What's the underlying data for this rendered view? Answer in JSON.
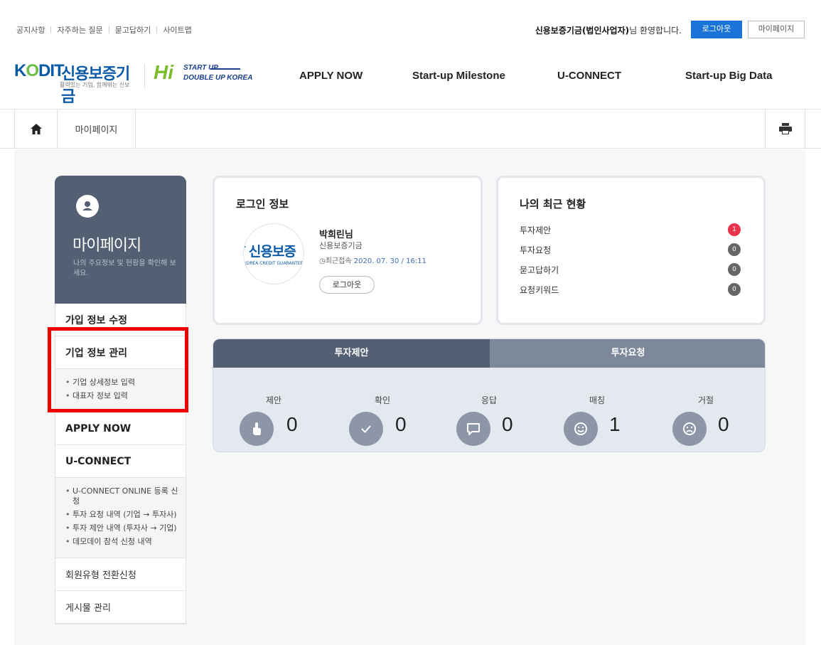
{
  "utility": {
    "links": [
      "공지사항",
      "자주하는 질문",
      "묻고답하기",
      "사이트맵"
    ],
    "welcome_name": "신용보증기금(법인사업자)",
    "welcome_suffix": "님 환영합니다.",
    "logout": "로그아웃",
    "mypage": "마이페이지"
  },
  "header": {
    "logo_kodit": "K",
    "logo_kodit_o": "O",
    "logo_kodit_rest": "DIT",
    "logo_name": "신용보증기금",
    "logo_slogan": "활력있는 기업, 함께뛰는 신보",
    "hi": "Hi",
    "startup": "START UP",
    "doubleup": "DOUBLE UP KOREA",
    "nav": [
      "APPLY NOW",
      "Start-up Milestone",
      "U-CONNECT",
      "Start-up Big Data"
    ]
  },
  "breadcrumb": {
    "current": "마이페이지"
  },
  "sidebar": {
    "title": "마이페이지",
    "desc": "나의 주요정보 및 현황을 확인해 보세요.",
    "menu": {
      "m1": "가입 정보 수정",
      "m2": "기업 정보 관리",
      "m2_sub": [
        "기업 상세정보 입력",
        "대표자 정보 입력"
      ],
      "m3": "APPLY NOW",
      "m4": "U-CONNECT",
      "m4_sub": [
        "U-CONNECT ONLINE 등록 신청",
        "투자 요청 내역 (기업 → 투자사)",
        "투자 제안 내역 (투자사 → 기업)",
        "데모데이 참석 신청 내역"
      ],
      "m5": "회원유형 전환신청",
      "m6": "게시물 관리"
    }
  },
  "login_card": {
    "title": "로그인 정보",
    "avatar_big": "ſ 신용보증",
    "avatar_small": "KOREA CREDIT GUARANTEE",
    "user_name": "박희린님",
    "org": "신용보증기금",
    "last_label": "최근접속",
    "last_time": "2020. 07. 30 / 16:11",
    "logout_button": "로그아웃"
  },
  "status_card": {
    "title": "나의 최근 현황",
    "rows": [
      {
        "label": "투자제안",
        "count": "1"
      },
      {
        "label": "투자요청",
        "count": "0"
      },
      {
        "label": "묻고답하기",
        "count": "0"
      },
      {
        "label": "요청키워드",
        "count": "0"
      }
    ]
  },
  "tabs": {
    "t1": "투자제안",
    "t2": "투자요청",
    "stats": [
      {
        "label": "제안",
        "value": "0",
        "icon": "hand-pointer-icon"
      },
      {
        "label": "확인",
        "value": "0",
        "icon": "check-icon"
      },
      {
        "label": "응답",
        "value": "0",
        "icon": "chat-icon"
      },
      {
        "label": "매칭",
        "value": "1",
        "icon": "smile-icon"
      },
      {
        "label": "거절",
        "value": "0",
        "icon": "sad-icon"
      }
    ]
  },
  "colors": {
    "accent_blue": "#1a73d9",
    "sidebar_dark": "#535f73",
    "badge_red": "#e8334a",
    "highlight_red": "#ee0000"
  }
}
